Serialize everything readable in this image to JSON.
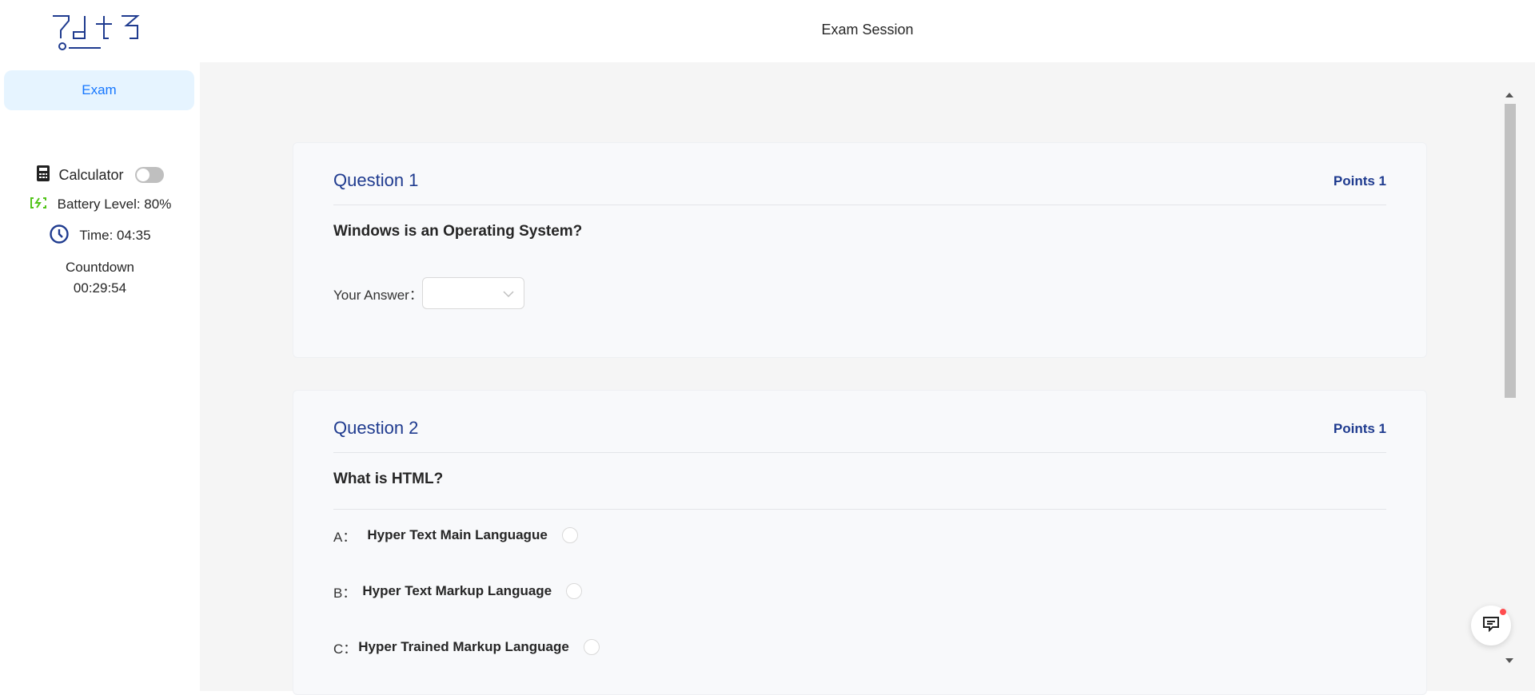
{
  "header": {
    "logo_icon": "brand-logo",
    "title": "Exam Session"
  },
  "sidebar": {
    "menu": [
      {
        "label": "Exam",
        "selected": true
      }
    ],
    "calculator": {
      "icon": "calculator-icon",
      "label": "Calculator",
      "enabled": false
    },
    "battery": {
      "icon": "battery-charging-icon",
      "label": "Battery Level: 80%",
      "color": "#52c41a"
    },
    "time": {
      "icon": "clock-icon",
      "label": "Time: 04:35",
      "color": "#1f3b8f"
    },
    "countdown": {
      "label": "Countdown",
      "value": "00:29:54"
    }
  },
  "questions": [
    {
      "title": "Question 1",
      "points": "Points 1",
      "text": "Windows is an Operating System?",
      "answer_label": "Your Answer：",
      "answer_value": ""
    },
    {
      "title": "Question 2",
      "points": "Points 1",
      "text": "What is HTML?",
      "options": [
        {
          "letter": "A：",
          "text": "Hyper Text Main Languague"
        },
        {
          "letter": "B：",
          "text": "Hyper Text Markup Language"
        },
        {
          "letter": "C：",
          "text": "Hyper Trained Markup Language"
        }
      ]
    }
  ],
  "chat": {
    "icon": "chat-icon",
    "has_notification": true
  },
  "colors": {
    "accent": "#1677ff",
    "heading": "#1f3b8f",
    "notification": "#ff4d4f"
  }
}
